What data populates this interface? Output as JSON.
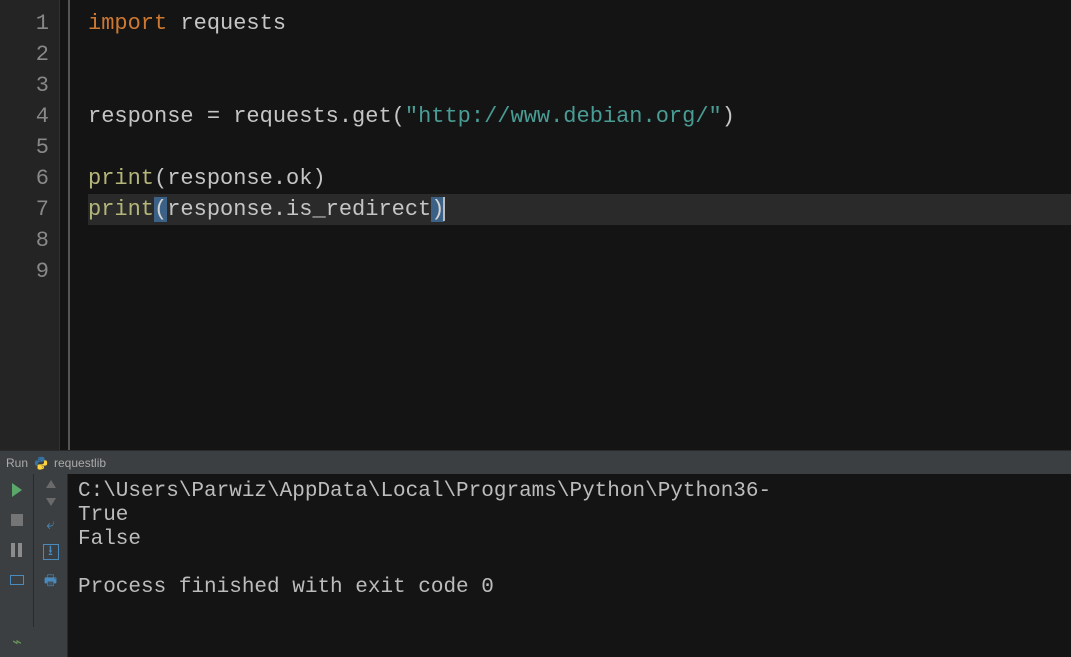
{
  "editor": {
    "lines": [
      "1",
      "2",
      "3",
      "4",
      "5",
      "6",
      "7",
      "8",
      "9"
    ],
    "code": {
      "l1a": "import",
      "l1b": " requests",
      "l4a": "response ",
      "l4b": "=",
      "l4c": " requests.get(",
      "l4d": "\"http://www.debian.org/\"",
      "l4e": ")",
      "l6a": "print",
      "l6b": "(response.ok)",
      "l7a": "print",
      "l7b": "(",
      "l7c": "response.is_redirect",
      "l7d": ")"
    }
  },
  "run_header": {
    "title_prefix": "Run",
    "tab": "requestlib"
  },
  "console": {
    "path": "C:\\Users\\Parwiz\\AppData\\Local\\Programs\\Python\\Python36-",
    "out1": "True",
    "out2": "False",
    "exit": "Process finished with exit code 0"
  }
}
